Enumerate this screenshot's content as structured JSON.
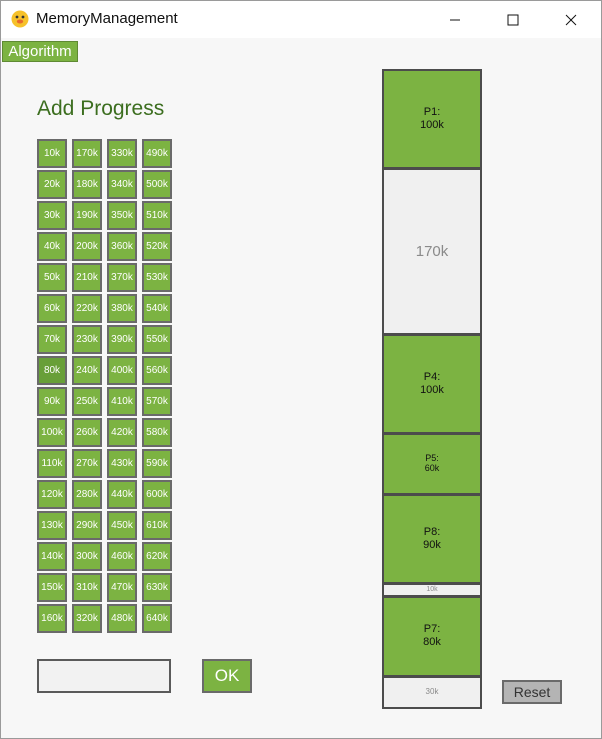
{
  "window": {
    "title": "MemoryManagement",
    "icon": "duck-face-icon"
  },
  "menu": {
    "algorithm_label": "Algorithm"
  },
  "panel": {
    "heading": "Add Progress"
  },
  "size_columns": [
    [
      "10k",
      "20k",
      "30k",
      "40k",
      "50k",
      "60k",
      "70k",
      "80k",
      "90k",
      "100k",
      "110k",
      "120k",
      "130k",
      "140k",
      "150k",
      "160k"
    ],
    [
      "170k",
      "180k",
      "190k",
      "200k",
      "210k",
      "220k",
      "230k",
      "240k",
      "250k",
      "260k",
      "270k",
      "280k",
      "290k",
      "300k",
      "310k",
      "320k"
    ],
    [
      "330k",
      "340k",
      "350k",
      "360k",
      "370k",
      "380k",
      "390k",
      "400k",
      "410k",
      "420k",
      "430k",
      "440k",
      "450k",
      "460k",
      "470k",
      "480k"
    ],
    [
      "490k",
      "500k",
      "510k",
      "520k",
      "530k",
      "540k",
      "550k",
      "560k",
      "570k",
      "580k",
      "590k",
      "600k",
      "610k",
      "620k",
      "630k",
      "640k"
    ]
  ],
  "size_input": {
    "value": "",
    "placeholder": ""
  },
  "ok_label": "OK",
  "reset_label": "Reset",
  "memory_total_k": 640,
  "memory_blocks": [
    {
      "type": "process",
      "name": "P1:",
      "size_label": "100k",
      "size_k": 100
    },
    {
      "type": "free",
      "name": "",
      "size_label": "170k",
      "size_k": 170
    },
    {
      "type": "process",
      "name": "P4:",
      "size_label": "100k",
      "size_k": 100
    },
    {
      "type": "process",
      "name": "P5:",
      "size_label": "60k",
      "size_k": 60
    },
    {
      "type": "process",
      "name": "P8:",
      "size_label": "90k",
      "size_k": 90
    },
    {
      "type": "free",
      "name": "",
      "size_label": "10k",
      "size_k": 10
    },
    {
      "type": "process",
      "name": "P7:",
      "size_label": "80k",
      "size_k": 80
    },
    {
      "type": "free",
      "name": "",
      "size_label": "30k",
      "size_k": 30
    }
  ],
  "colors": {
    "process": "#7cb342",
    "free": "#f0f0f0",
    "heading": "#3c6e1f",
    "reset": "#b4b4b4"
  }
}
